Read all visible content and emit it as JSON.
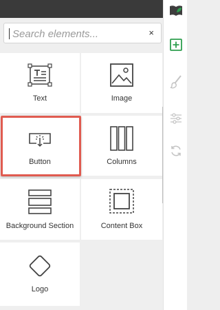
{
  "search": {
    "placeholder": "Search elements...",
    "clear_label": "×"
  },
  "elements": [
    {
      "label": "Text"
    },
    {
      "label": "Image"
    },
    {
      "label": "Button"
    },
    {
      "label": "Columns"
    },
    {
      "label": "Background Section"
    },
    {
      "label": "Content Box"
    },
    {
      "label": "Logo"
    }
  ],
  "rail": {
    "icons": [
      "book-leaf-icon",
      "add-element-icon",
      "brush-icon",
      "settings-sliders-icon",
      "sync-icon"
    ],
    "accent": "#2e9e4f"
  },
  "colors": {
    "highlight": "#e05b50",
    "topbar": "#3a3a3a"
  }
}
